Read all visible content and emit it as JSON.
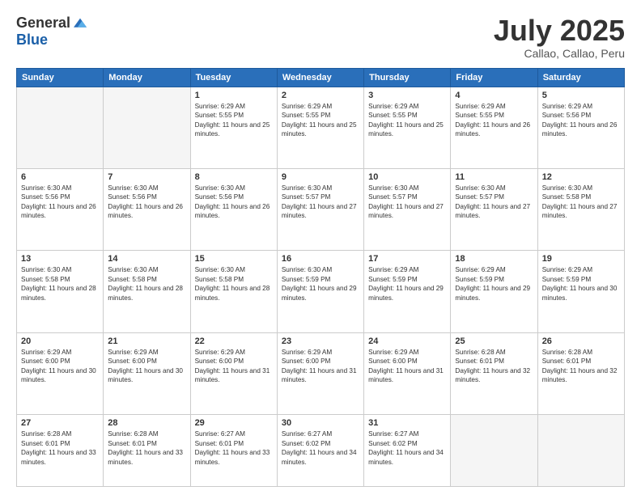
{
  "logo": {
    "general": "General",
    "blue": "Blue"
  },
  "header": {
    "month": "July 2025",
    "location": "Callao, Callao, Peru"
  },
  "weekdays": [
    "Sunday",
    "Monday",
    "Tuesday",
    "Wednesday",
    "Thursday",
    "Friday",
    "Saturday"
  ],
  "weeks": [
    [
      {
        "day": "",
        "info": ""
      },
      {
        "day": "",
        "info": ""
      },
      {
        "day": "1",
        "info": "Sunrise: 6:29 AM\nSunset: 5:55 PM\nDaylight: 11 hours and 25 minutes."
      },
      {
        "day": "2",
        "info": "Sunrise: 6:29 AM\nSunset: 5:55 PM\nDaylight: 11 hours and 25 minutes."
      },
      {
        "day": "3",
        "info": "Sunrise: 6:29 AM\nSunset: 5:55 PM\nDaylight: 11 hours and 25 minutes."
      },
      {
        "day": "4",
        "info": "Sunrise: 6:29 AM\nSunset: 5:55 PM\nDaylight: 11 hours and 26 minutes."
      },
      {
        "day": "5",
        "info": "Sunrise: 6:29 AM\nSunset: 5:56 PM\nDaylight: 11 hours and 26 minutes."
      }
    ],
    [
      {
        "day": "6",
        "info": "Sunrise: 6:30 AM\nSunset: 5:56 PM\nDaylight: 11 hours and 26 minutes."
      },
      {
        "day": "7",
        "info": "Sunrise: 6:30 AM\nSunset: 5:56 PM\nDaylight: 11 hours and 26 minutes."
      },
      {
        "day": "8",
        "info": "Sunrise: 6:30 AM\nSunset: 5:56 PM\nDaylight: 11 hours and 26 minutes."
      },
      {
        "day": "9",
        "info": "Sunrise: 6:30 AM\nSunset: 5:57 PM\nDaylight: 11 hours and 27 minutes."
      },
      {
        "day": "10",
        "info": "Sunrise: 6:30 AM\nSunset: 5:57 PM\nDaylight: 11 hours and 27 minutes."
      },
      {
        "day": "11",
        "info": "Sunrise: 6:30 AM\nSunset: 5:57 PM\nDaylight: 11 hours and 27 minutes."
      },
      {
        "day": "12",
        "info": "Sunrise: 6:30 AM\nSunset: 5:58 PM\nDaylight: 11 hours and 27 minutes."
      }
    ],
    [
      {
        "day": "13",
        "info": "Sunrise: 6:30 AM\nSunset: 5:58 PM\nDaylight: 11 hours and 28 minutes."
      },
      {
        "day": "14",
        "info": "Sunrise: 6:30 AM\nSunset: 5:58 PM\nDaylight: 11 hours and 28 minutes."
      },
      {
        "day": "15",
        "info": "Sunrise: 6:30 AM\nSunset: 5:58 PM\nDaylight: 11 hours and 28 minutes."
      },
      {
        "day": "16",
        "info": "Sunrise: 6:30 AM\nSunset: 5:59 PM\nDaylight: 11 hours and 29 minutes."
      },
      {
        "day": "17",
        "info": "Sunrise: 6:29 AM\nSunset: 5:59 PM\nDaylight: 11 hours and 29 minutes."
      },
      {
        "day": "18",
        "info": "Sunrise: 6:29 AM\nSunset: 5:59 PM\nDaylight: 11 hours and 29 minutes."
      },
      {
        "day": "19",
        "info": "Sunrise: 6:29 AM\nSunset: 5:59 PM\nDaylight: 11 hours and 30 minutes."
      }
    ],
    [
      {
        "day": "20",
        "info": "Sunrise: 6:29 AM\nSunset: 6:00 PM\nDaylight: 11 hours and 30 minutes."
      },
      {
        "day": "21",
        "info": "Sunrise: 6:29 AM\nSunset: 6:00 PM\nDaylight: 11 hours and 30 minutes."
      },
      {
        "day": "22",
        "info": "Sunrise: 6:29 AM\nSunset: 6:00 PM\nDaylight: 11 hours and 31 minutes."
      },
      {
        "day": "23",
        "info": "Sunrise: 6:29 AM\nSunset: 6:00 PM\nDaylight: 11 hours and 31 minutes."
      },
      {
        "day": "24",
        "info": "Sunrise: 6:29 AM\nSunset: 6:00 PM\nDaylight: 11 hours and 31 minutes."
      },
      {
        "day": "25",
        "info": "Sunrise: 6:28 AM\nSunset: 6:01 PM\nDaylight: 11 hours and 32 minutes."
      },
      {
        "day": "26",
        "info": "Sunrise: 6:28 AM\nSunset: 6:01 PM\nDaylight: 11 hours and 32 minutes."
      }
    ],
    [
      {
        "day": "27",
        "info": "Sunrise: 6:28 AM\nSunset: 6:01 PM\nDaylight: 11 hours and 33 minutes."
      },
      {
        "day": "28",
        "info": "Sunrise: 6:28 AM\nSunset: 6:01 PM\nDaylight: 11 hours and 33 minutes."
      },
      {
        "day": "29",
        "info": "Sunrise: 6:27 AM\nSunset: 6:01 PM\nDaylight: 11 hours and 33 minutes."
      },
      {
        "day": "30",
        "info": "Sunrise: 6:27 AM\nSunset: 6:02 PM\nDaylight: 11 hours and 34 minutes."
      },
      {
        "day": "31",
        "info": "Sunrise: 6:27 AM\nSunset: 6:02 PM\nDaylight: 11 hours and 34 minutes."
      },
      {
        "day": "",
        "info": ""
      },
      {
        "day": "",
        "info": ""
      }
    ]
  ]
}
